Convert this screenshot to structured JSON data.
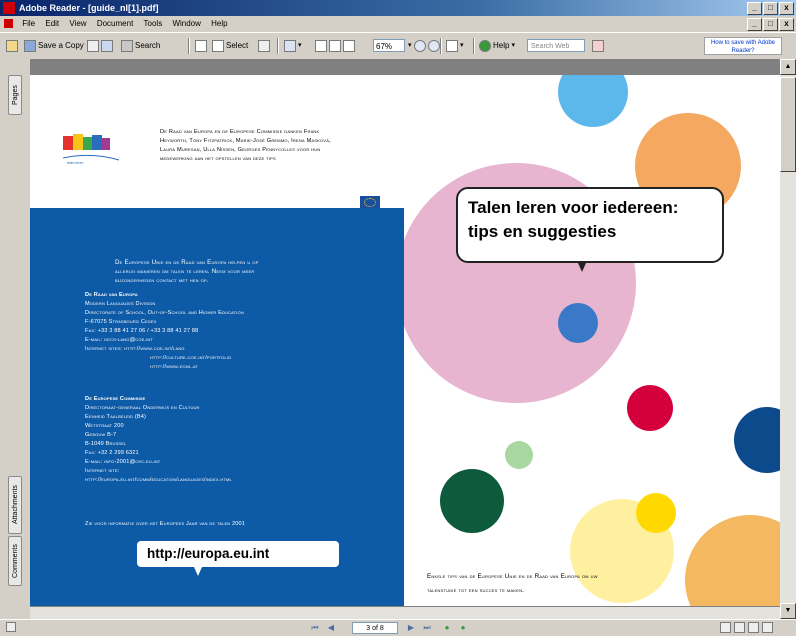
{
  "window": {
    "title": "Adobe Reader - [guide_nl[1].pdf]",
    "buttons": [
      "_",
      "□",
      "x"
    ]
  },
  "menu": {
    "items": [
      "File",
      "Edit",
      "View",
      "Document",
      "Tools",
      "Window",
      "Help"
    ],
    "doc_buttons": [
      "_",
      "□",
      "x"
    ]
  },
  "toolbar": {
    "save_copy": "Save a Copy",
    "search": "Search",
    "select": "Select",
    "zoom_value": "67%",
    "help": "Help",
    "search_placeholder": "Search Web",
    "promo": "How to save with Adobe Reader?"
  },
  "nav_tabs": {
    "pages": "Pages",
    "attachments": "Attachments",
    "comments": "Comments"
  },
  "status": {
    "page_indicator": "3 of 8"
  },
  "page": {
    "intro_lines": [
      "De Raad van Europa en de Europese Commissie danken Frank",
      "Heyworth, Tony Fitzpatrick, Marie-José Gremmo, Irena Masková,",
      "Laura Muresan, Ulla Nissen, Georges Pennycolles voor hun",
      "medewerking aan het opstellen van deze tips"
    ],
    "blue_intro": [
      "De Europese Unie en de Raad van Europa helpen u op",
      "allerlei manieren om talen te leren. Neem voor meer",
      "bijzonderheden contact met hen op."
    ],
    "council": {
      "heading": "De Raad van Europa",
      "lines": [
        "Modern Languages Division",
        "Directorate of School, Out-of-School and Higher Education",
        "F-67075 Strasbourg Cedex",
        "Fax: +33 3 88 41 27 06 / +33 3 88 41 27 88",
        "E-mail: decs-lang@coe.int",
        "Internet sites: http://www.coe.int/lang"
      ],
      "indented": [
        "http://culture.coe.int/portfolio",
        "http://www.ecml.at"
      ]
    },
    "commission": {
      "heading": "De Europese Commissie",
      "lines": [
        "Directoraat-generaal Onderwijs en Cultuur",
        "Eenheid Taalbeleid (B4)",
        "Wetstraat 200",
        "Gebouw B-7",
        "B-1049 Brussel",
        "Fax: +32 2 299 6321",
        "E-mail: info-2001@cec.eu.int",
        "Internet site:",
        "http://europa.eu.int/comm/education/languages/index.html"
      ]
    },
    "more_info": "Zie voor informatie over het Europees Jaar van de talen 2001",
    "url": "http://europa.eu.int",
    "bubble_line1": "Talen leren voor iedereen:",
    "bubble_line2": "tips en suggesties",
    "footer_line1": "Enkele tips van de Europese Unie en de Raad van Europa om uw",
    "footer_line2": "talenstudie tot een succes te maken."
  },
  "colors": {
    "blue_panel": "#0d5aa7",
    "pink": "#e8b5d0",
    "orange": "#f4a860",
    "light_blue": "#5cb8ea",
    "crimson": "#d4003c",
    "dark_green": "#0d5a3c",
    "navy": "#0d4a8c",
    "light_green": "#a8d8a0",
    "yellow": "#fff0a0",
    "gold": "#ffd800"
  }
}
